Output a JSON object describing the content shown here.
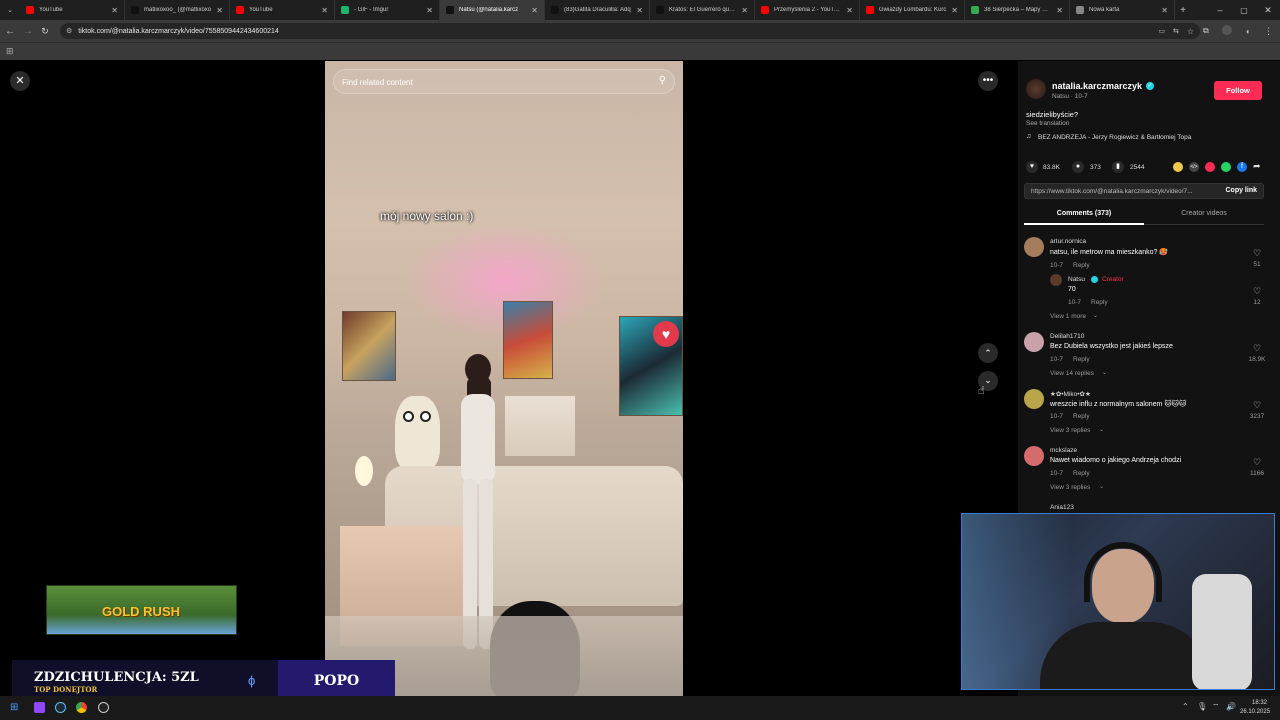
{
  "browser": {
    "tabs": [
      {
        "title": "YouTube",
        "color": "#ff0000",
        "active": false
      },
      {
        "title": "matlixoxoo_ (@matlixoxo",
        "color": "#111111",
        "active": false
      },
      {
        "title": "YouTube",
        "color": "#ff0000",
        "active": false
      },
      {
        "title": "- GIF - Imgur",
        "color": "#1bb76e",
        "active": false
      },
      {
        "title": "Natsu (@natalia.karcz",
        "color": "#111111",
        "active": true
      },
      {
        "title": "(83)Gatita Draculilla: Adq",
        "color": "#111111",
        "active": false
      },
      {
        "title": "Kratos: El Guerrero que N",
        "color": "#111111",
        "active": false
      },
      {
        "title": "Przemyślenia 2 - YouTube",
        "color": "#ff0000",
        "active": false
      },
      {
        "title": "Gwiazdy Lombardu: Kurc",
        "color": "#ff0000",
        "active": false
      },
      {
        "title": "38 Sierpecka – Mapy Goo",
        "color": "#34a853",
        "active": false
      },
      {
        "title": "Nowa karta",
        "color": "#888888",
        "active": false
      }
    ],
    "url": "tiktok.com/@natalia.karczmarczyk/video/7558509442434600214"
  },
  "video": {
    "search_placeholder": "Find related content",
    "caption": "mój nowy salon :)"
  },
  "author": {
    "username": "natalia.karczmarczyk",
    "nickname_date": "Natsu · 10-7",
    "follow_label": "Follow",
    "description": "siedzielibyście?",
    "see_translation": "See translation",
    "music": "BEZ ANDRZEJA - Jerzy Rogiewicz & Bartłomiej Topa"
  },
  "stats": {
    "likes": "83.8K",
    "comments": "373",
    "saves": "2544"
  },
  "link": {
    "url": "https://www.tiktok.com/@natalia.karczmarczyk/video/7...",
    "copy_label": "Copy link"
  },
  "tabs": {
    "comments": "Comments (373)",
    "creator_videos": "Creator videos"
  },
  "comments": [
    {
      "user": "artur.nornica",
      "text": "natsu, ile metrow ma mieszkanko? 🥵",
      "date": "10-7",
      "reply": "Reply",
      "likes": "51"
    },
    {
      "user": "Natsu",
      "creator_badge": "Creator",
      "text": "70",
      "date": "10-7",
      "reply": "Reply",
      "likes": "12",
      "more": "View 1 more"
    },
    {
      "user": "Delilah1710",
      "text": "Bez Dubiela wszystko jest jakieś lepsze",
      "date": "10-7",
      "reply": "Reply",
      "likes": "18.9K",
      "replies": "View 14 replies"
    },
    {
      "user": "★✿•Miko•✿★",
      "text": "wreszcie influ z normalnym salonem 🐱🐱🐱",
      "date": "10-7",
      "reply": "Reply",
      "likes": "3237",
      "replies": "View 3 replies"
    },
    {
      "user": "mckslaze",
      "text": "Nawet wiadomo o jakiego Andrzeja chodzi",
      "date": "10-7",
      "reply": "Reply",
      "likes": "1166",
      "replies": "View 3 replies"
    },
    {
      "user": "Ania123"
    }
  ],
  "overlay": {
    "game_banner": "GOLD RUSH",
    "donor_title": "ZDZICHULENCJA: 5ZL",
    "donor_sub": "TOP DONEJTOR",
    "popo": "POPO"
  },
  "taskbar": {
    "time": "18:32",
    "date": "26.10.2025"
  }
}
